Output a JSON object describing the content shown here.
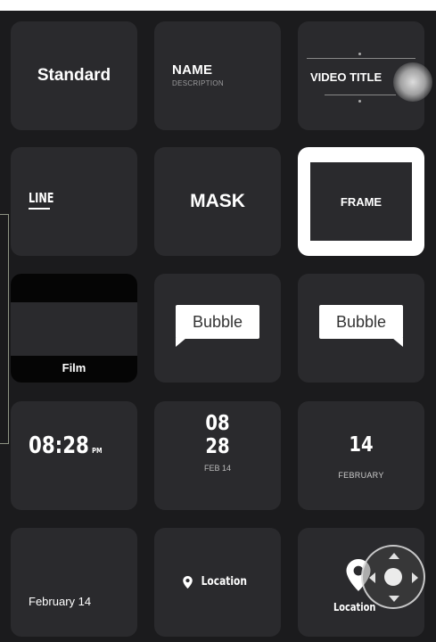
{
  "colors": {
    "background": "#1b1b1d",
    "tile": "#2a2a2d",
    "selected_frame": "#ffffff",
    "bubble": "#ffffff"
  },
  "tiles": {
    "standard": {
      "label": "Standard"
    },
    "name_desc": {
      "name": "NAME",
      "description": "DESCRIPTION"
    },
    "video_title": {
      "label": "VIDEO TITLE"
    },
    "line": {
      "label": "LINE"
    },
    "mask": {
      "label": "MASK"
    },
    "frame": {
      "label": "FRAME",
      "selected": true
    },
    "film": {
      "label": "Film"
    },
    "bubble_left": {
      "label": "Bubble"
    },
    "bubble_right": {
      "label": "Bubble"
    },
    "clock": {
      "time": "08:28",
      "ampm": "PM"
    },
    "date_stack": {
      "month": "08",
      "day": "28",
      "sub": "FEB 14"
    },
    "big_date": {
      "day": "14",
      "month": "FEBRUARY"
    },
    "date_text": {
      "label": "February 14"
    },
    "location_inline": {
      "label": "Location",
      "icon": "location-pin-icon"
    },
    "location_stacked": {
      "label": "Location",
      "icon": "location-pin-icon"
    }
  },
  "overlays": {
    "joystick": "dpad-joystick-icon",
    "touch_indicator": "touch-indicator"
  }
}
